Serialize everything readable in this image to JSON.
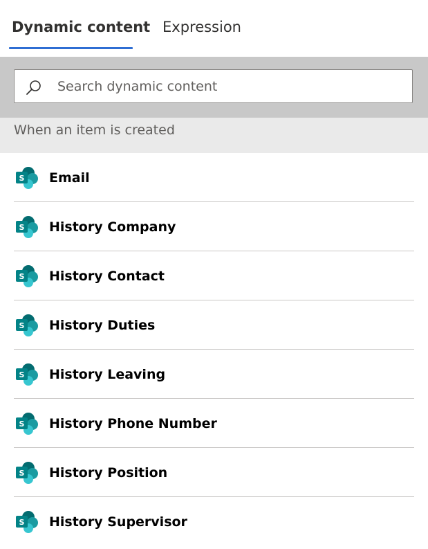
{
  "tabs": {
    "dynamic_content": "Dynamic content",
    "expression": "Expression"
  },
  "search": {
    "placeholder": "Search dynamic content",
    "value": ""
  },
  "section": {
    "title": "When an item is created"
  },
  "items": [
    {
      "label": "Email",
      "icon": "sharepoint-icon"
    },
    {
      "label": "History Company",
      "icon": "sharepoint-icon"
    },
    {
      "label": "History Contact",
      "icon": "sharepoint-icon"
    },
    {
      "label": "History Duties",
      "icon": "sharepoint-icon"
    },
    {
      "label": "History Leaving",
      "icon": "sharepoint-icon"
    },
    {
      "label": "History Phone Number",
      "icon": "sharepoint-icon"
    },
    {
      "label": "History Position",
      "icon": "sharepoint-icon"
    },
    {
      "label": "History Supervisor",
      "icon": "sharepoint-icon"
    }
  ],
  "colors": {
    "accent": "#2f6ed3",
    "search_band": "#c8c8c8",
    "section_band": "#eaeaea",
    "sharepoint_dark": "#036c70",
    "sharepoint_mid": "#1a9ba1",
    "sharepoint_light": "#37c6d0"
  }
}
